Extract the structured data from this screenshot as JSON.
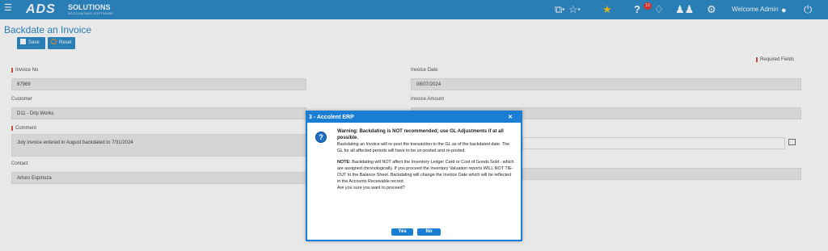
{
  "topbar": {
    "logo_main": "ADS",
    "logo_sub": "SOLUTIONS",
    "logo_tagline": "ACCOUNTING SOFTWARE",
    "notification_count": "10",
    "welcome": "Welcome Admin"
  },
  "page": {
    "title": "Backdate an Invoice",
    "save_label": "Save",
    "reset_label": "Reset",
    "required_fields": "Required Fields"
  },
  "form": {
    "invoice_no_label": "Invoice No",
    "invoice_no": "67969",
    "invoice_date_label": "Invoice Date",
    "invoice_date": "08/07/2024",
    "customer_label": "Customer",
    "customer": "D11 - Drip Works",
    "invoice_amount_label": "Invoice Amount",
    "comment_label": "Comment",
    "comment": "July invoice entered in August backdated to 7/31/2024",
    "contact_label": "Contact",
    "contact": "Arturo Espinoza"
  },
  "dialog": {
    "title": "3 - Accolent ERP",
    "warning": "Warning: Backdating is NOT recommended; use GL Adjustments if at all possible.",
    "line1": "Backdating an Invoice will re-post the transaction to the GL as of the backdated date. The GL for all affected periods will have to be un-posted and re-posted.",
    "note_label": "NOTE:",
    "note": " Backdating will NOT affect the Inventory Ledger Card or Cost of Goods Sold - which are assigned chronologically. If you proceed the Inventory Valuation reports WILL NOT TIE-OUT to the Balance Sheet. Backdating will change the Invoice Date which will be reflected in the Accounts Receivable record.",
    "question": "Are you sure you want to proceed?",
    "yes_label": "Yes",
    "no_label": "No"
  },
  "colors": {
    "primary": "#2e8bc9",
    "dialog_accent": "#1a7fd4",
    "required": "#d9534f",
    "badge": "#e0352f"
  }
}
